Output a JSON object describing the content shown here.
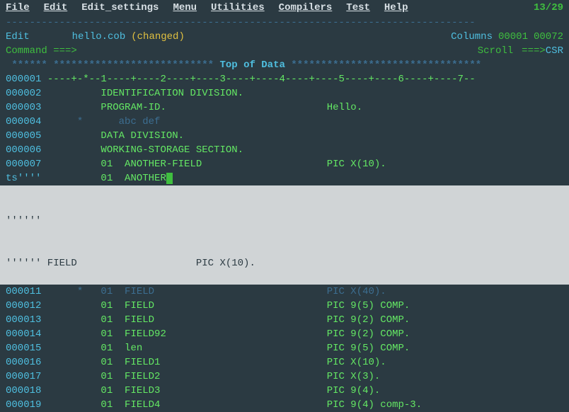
{
  "menu": {
    "items": [
      "File",
      "Edit",
      "Edit_settings",
      "Menu",
      "Utilities",
      "Compilers",
      "Test",
      "Help"
    ],
    "position": "13/29"
  },
  "status": {
    "mode": "Edit",
    "filename": "hello.cob",
    "changed": "(changed)",
    "columns_label": "Columns",
    "col_from": "00001",
    "col_to": "00072"
  },
  "command": {
    "label": "Command  ===>",
    "value": "",
    "scroll_label": "Scroll",
    "scroll_arrow": "===>",
    "scroll_value": "CSR"
  },
  "topdata": {
    "stars_left": " ****** ***************************",
    "label": " Top of Data ",
    "stars_right": "********************************"
  },
  "ruler": {
    "lineno": "000001",
    "text": " ----+-*--1----+----2----+----3----+----4----+----5----+----6----+----7--"
  },
  "lines": [
    {
      "lineno": "000002",
      "text": "          IDENTIFICATION DIVISION."
    },
    {
      "lineno": "000003",
      "text": "          PROGRAM-ID.                           Hello."
    },
    {
      "lineno": "000004",
      "comment": true,
      "text": "      *      abc def"
    },
    {
      "lineno": "000005",
      "text": "          DATA DIVISION."
    },
    {
      "lineno": "000006",
      "text": "          WORKING-STORAGE SECTION."
    },
    {
      "lineno": "000007",
      "text": "          01  ANOTHER-FIELD                     PIC X(10)."
    }
  ],
  "active": {
    "lineno": "ts''''",
    "prefix": "          01  ANOTHER"
  },
  "highlight": [
    "''''''",
    "'''''' FIELD                    PIC X(10)."
  ],
  "after": [
    {
      "lineno": "000011",
      "comment": true,
      "text": "      *   01  FIELD                             PIC X(40)."
    },
    {
      "lineno": "000012",
      "text": "          01  FIELD                             PIC 9(5) COMP."
    },
    {
      "lineno": "000013",
      "text": "          01  FIELD                             PIC 9(2) COMP."
    },
    {
      "lineno": "000014",
      "text": "          01  FIELD92                           PIC 9(2) COMP."
    },
    {
      "lineno": "000015",
      "text": "          01  len                               PIC 9(5) COMP."
    },
    {
      "lineno": "000016",
      "text": "          01  FIELD1                            PIC X(10)."
    },
    {
      "lineno": "000017",
      "text": "          01  FIELD2                            PIC X(3)."
    },
    {
      "lineno": "000018",
      "text": "          01  FIELD3                            PIC 9(4)."
    },
    {
      "lineno": "000019",
      "text": "          01  FIELD4                            PIC 9(4) comp-3."
    }
  ]
}
